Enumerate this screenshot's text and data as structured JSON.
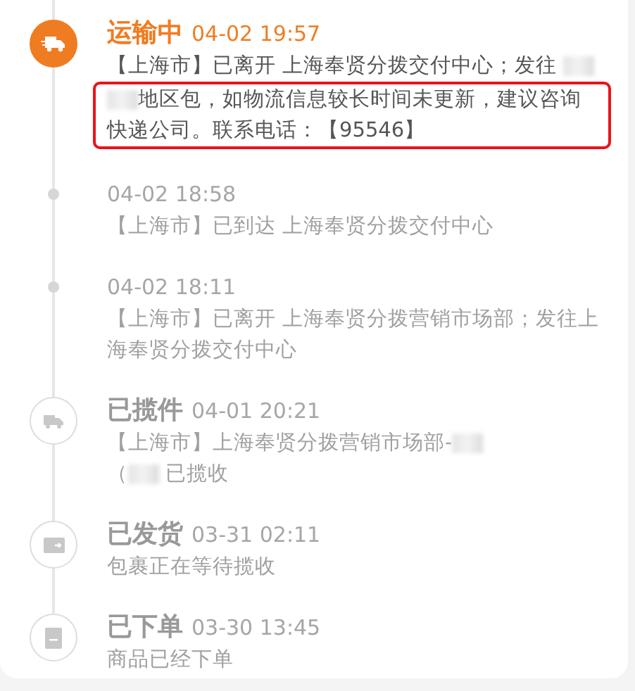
{
  "events": [
    {
      "kind": "transit",
      "current": true,
      "status": "运输中",
      "time": "04-02 19:57",
      "paragraphs": [
        {
          "highlighted": false,
          "parts": [
            {
              "kind": "text",
              "text": "【上海市】已离开 上海奉贤分拨交付中心；发往 "
            },
            {
              "kind": "redacted"
            }
          ]
        },
        {
          "highlighted": true,
          "parts": [
            {
              "kind": "redacted"
            },
            {
              "kind": "text",
              "text": "地区包，如物流信息较长时间未更新，建议咨询快递公司。联系电话：【95546】"
            }
          ]
        }
      ]
    },
    {
      "kind": "update",
      "current": false,
      "time": "04-02 18:58",
      "paragraphs": [
        {
          "highlighted": false,
          "parts": [
            {
              "kind": "text",
              "text": "【上海市】已到达 上海奉贤分拨交付中心"
            }
          ]
        }
      ]
    },
    {
      "kind": "update",
      "current": false,
      "time": "04-02 18:11",
      "paragraphs": [
        {
          "highlighted": false,
          "parts": [
            {
              "kind": "text",
              "text": "【上海市】已离开 上海奉贤分拨营销市场部；发往上海奉贤分拨交付中心"
            }
          ]
        }
      ]
    },
    {
      "kind": "pickup",
      "current": false,
      "status": "已揽件",
      "time": "04-01 20:21",
      "paragraphs": [
        {
          "highlighted": false,
          "parts": [
            {
              "kind": "text",
              "text": "【上海市】上海奉贤分拨营销市场部-"
            },
            {
              "kind": "redacted"
            }
          ]
        },
        {
          "highlighted": false,
          "parts": [
            {
              "kind": "text",
              "text": "（"
            },
            {
              "kind": "redacted"
            },
            {
              "kind": "text",
              "text": " 已揽收"
            }
          ]
        }
      ]
    },
    {
      "kind": "shipped",
      "current": false,
      "status": "已发货",
      "time": "03-31 02:11",
      "paragraphs": [
        {
          "highlighted": false,
          "parts": [
            {
              "kind": "text",
              "text": "包裹正在等待揽收"
            }
          ]
        }
      ]
    },
    {
      "kind": "ordered",
      "current": false,
      "status": "已下单",
      "time": "03-30 13:45",
      "paragraphs": [
        {
          "highlighted": false,
          "parts": [
            {
              "kind": "text",
              "text": "商品已经下单"
            }
          ]
        }
      ]
    }
  ]
}
